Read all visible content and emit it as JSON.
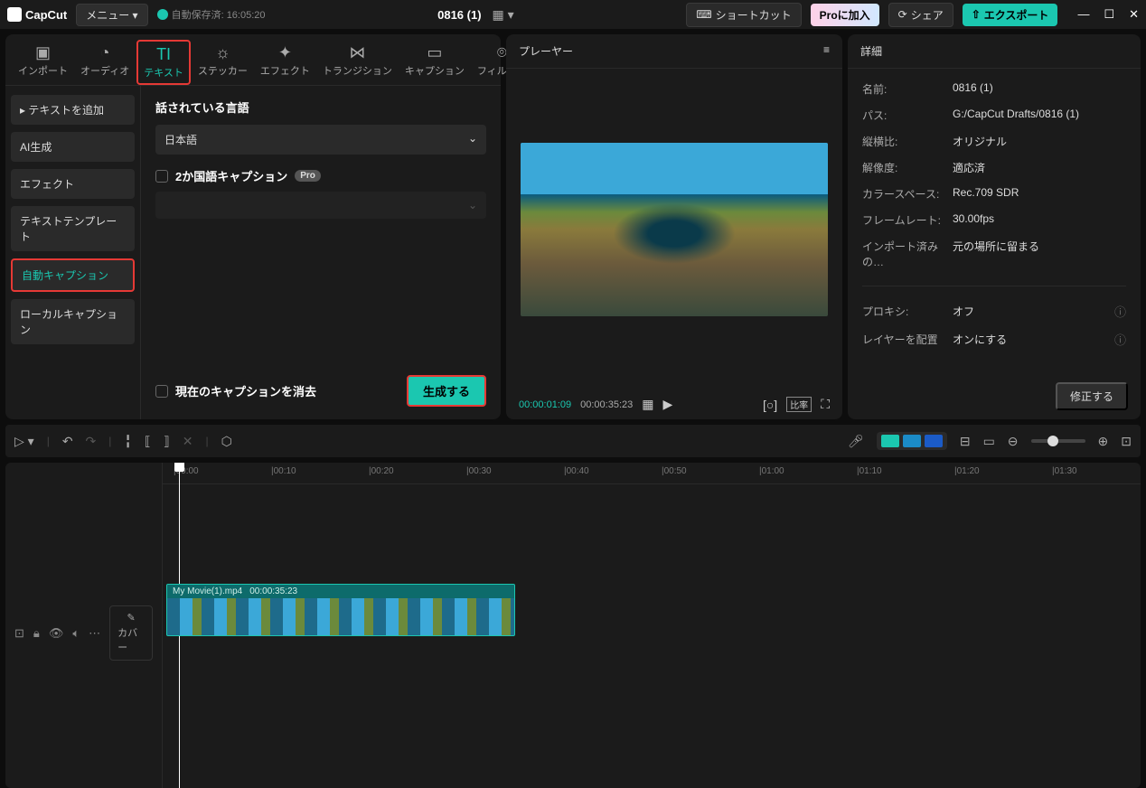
{
  "titlebar": {
    "app_name": "CapCut",
    "menu_label": "メニュー ▾",
    "autosave": "自動保存済: 16:05:20",
    "project_name": "0816 (1)",
    "shortcut": "ショートカット",
    "pro": "Proに加入",
    "share": "シェア",
    "export": "エクスポート"
  },
  "tabs": {
    "import": "インポート",
    "audio": "オーディオ",
    "text": "テキスト",
    "sticker": "ステッカー",
    "effect": "エフェクト",
    "transition": "トランジション",
    "caption": "キャプション",
    "filter": "フィルター"
  },
  "side": {
    "add_text": "テキストを追加",
    "ai_gen": "AI生成",
    "effect": "エフェクト",
    "template": "テキストテンプレート",
    "auto_caption": "自動キャプション",
    "local_caption": "ローカルキャプション"
  },
  "settings": {
    "lang_label": "話されている言語",
    "lang_value": "日本語",
    "bilingual": "2か国語キャプション",
    "pro_badge": "Pro",
    "clear": "現在のキャプションを消去",
    "generate": "生成する"
  },
  "player": {
    "title": "プレーヤー",
    "time_current": "00:00:01:09",
    "time_total": "00:00:35:23",
    "ratio_label": "比率"
  },
  "details": {
    "title": "詳細",
    "name_k": "名前:",
    "name_v": "0816 (1)",
    "path_k": "パス:",
    "path_v": "G:/CapCut Drafts/0816 (1)",
    "aspect_k": "縦横比:",
    "aspect_v": "オリジナル",
    "res_k": "解像度:",
    "res_v": "適応済",
    "cs_k": "カラースペース:",
    "cs_v": "Rec.709 SDR",
    "fps_k": "フレームレート:",
    "fps_v": "30.00fps",
    "imp_k": "インポート済みの…",
    "imp_v": "元の場所に留まる",
    "proxy_k": "プロキシ:",
    "proxy_v": "オフ",
    "layer_k": "レイヤーを配置",
    "layer_v": "オンにする",
    "fix": "修正する"
  },
  "timeline": {
    "ticks": [
      "|00:00",
      "|00:10",
      "|00:20",
      "|00:30",
      "|00:40",
      "|00:50",
      "|01:00",
      "|01:10",
      "|01:20",
      "|01:30"
    ],
    "cover": "カバー",
    "clip_name": "My Movie(1).mp4",
    "clip_dur": "00:00:35:23"
  }
}
